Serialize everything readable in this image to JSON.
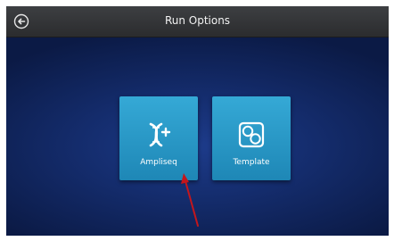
{
  "header": {
    "title": "Run Options",
    "back_icon": "back-arrow-icon"
  },
  "options": [
    {
      "label": "Ampliseq",
      "icon": "dna-plus-icon"
    },
    {
      "label": "Template",
      "icon": "template-circles-icon"
    }
  ],
  "colors": {
    "header_bg": "#333437",
    "background": "#142c6c",
    "tile": "#2a9bcb",
    "annotation_arrow": "#c4161c"
  }
}
